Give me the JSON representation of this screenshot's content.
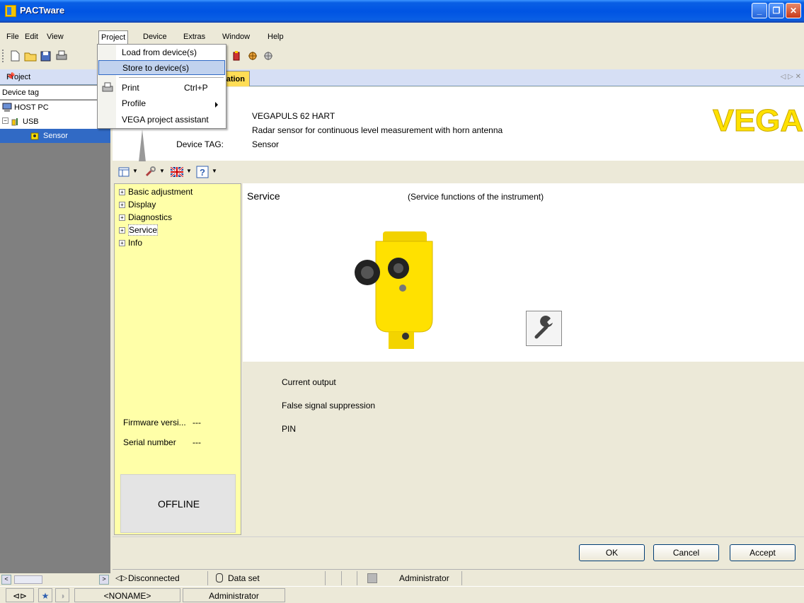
{
  "window": {
    "title": "PACTware",
    "controls": [
      "minimize-icon",
      "restore-icon",
      "close-icon"
    ]
  },
  "menubar": {
    "items": [
      {
        "label": "File"
      },
      {
        "label": "Edit"
      },
      {
        "label": "View"
      },
      {
        "label": "Project"
      },
      {
        "label": "Device"
      },
      {
        "label": "Extras"
      },
      {
        "label": "Window"
      },
      {
        "label": "Help"
      }
    ],
    "active": "Project"
  },
  "project_menu": {
    "items": [
      {
        "label": "Load from device(s)",
        "shortcut": ""
      },
      {
        "label": "Store to device(s)",
        "shortcut": ""
      },
      {
        "label": "Print",
        "shortcut": "Ctrl+P"
      },
      {
        "label": "Profile",
        "shortcut": ""
      },
      {
        "label": "VEGA project assistant",
        "shortcut": ""
      }
    ],
    "highlighted": "Store to device(s)"
  },
  "project_pane": {
    "title": "Project",
    "column_header": "Device tag",
    "tree": [
      {
        "label": "HOST PC"
      },
      {
        "label": "USB"
      },
      {
        "label": "Sensor"
      }
    ],
    "selected": "Sensor"
  },
  "document": {
    "tab_label": "ation",
    "device_header": {
      "device_label": "Device TAG:",
      "device_name": "VEGAPULS 62 HART",
      "description": "Radar sensor for continuous level measurement with horn antenna",
      "device_tag": "Sensor",
      "logo": "VEGA"
    },
    "nav_tree": [
      {
        "label": "Basic adjustment"
      },
      {
        "label": "Display"
      },
      {
        "label": "Diagnostics"
      },
      {
        "label": "Service"
      },
      {
        "label": "Info"
      }
    ],
    "nav_selected": "Service",
    "firmware_label": "Firmware versi...",
    "firmware_value": "---",
    "serial_label": "Serial number",
    "serial_value": "---",
    "offline_status": "OFFLINE",
    "service_panel": {
      "title": "Service",
      "subtitle": "(Service functions of the instrument)"
    },
    "service_items": [
      {
        "label": "Current output"
      },
      {
        "label": "False signal suppression"
      },
      {
        "label": "PIN"
      }
    ],
    "buttons": {
      "ok": "OK",
      "cancel": "Cancel",
      "accept": "Accept"
    },
    "status": {
      "connection": "Disconnected",
      "dataset": "Data set",
      "user": "Administrator"
    }
  },
  "statusbar": {
    "project_name": "<NONAME>",
    "user": "Administrator"
  },
  "colors": {
    "title_blue": "#0054e3",
    "tab_yellow": "#ffdd55",
    "nav_yellow": "#ffffa8",
    "selection_blue": "#316ac5",
    "sensor_yellow": "#ffe100"
  }
}
